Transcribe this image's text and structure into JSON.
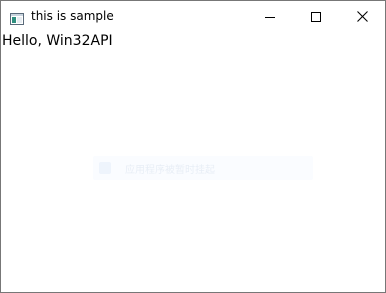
{
  "window": {
    "title": "this is sample",
    "icon": "app-window-icon"
  },
  "controls": {
    "minimize_icon": "minimize-icon",
    "maximize_icon": "maximize-icon",
    "close_icon": "close-icon"
  },
  "client": {
    "text": "Hello, Win32API"
  },
  "overlay": {
    "text": "应用程序被暂时挂起"
  }
}
